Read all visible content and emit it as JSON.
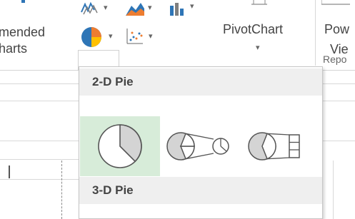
{
  "ribbon": {
    "recommended_label_line1": "mended",
    "recommended_label_line2": "harts",
    "pivotchart_label": "PivotChart",
    "powerview_label_line1": "Pow",
    "powerview_label_line2": "Vie",
    "reports_group_label": "Repo",
    "pie_button_icon": "pie-chart-icon",
    "scatter_button_icon": "scatter-chart-icon",
    "line_chart_icon": "line-chart-icon",
    "area_chart_icon": "area-chart-icon",
    "bar_stat_icon": "statistic-chart-icon",
    "accent_color": "#217346"
  },
  "dropdown": {
    "section_2d_label": "2-D Pie",
    "section_3d_label": "3-D Pie",
    "options": [
      {
        "name": "pie",
        "selected": true
      },
      {
        "name": "pie-of-pie",
        "selected": false
      },
      {
        "name": "bar-of-pie",
        "selected": false
      }
    ],
    "selected_color": "#d7ecd9",
    "slice_fill": "#d4d4d4"
  }
}
